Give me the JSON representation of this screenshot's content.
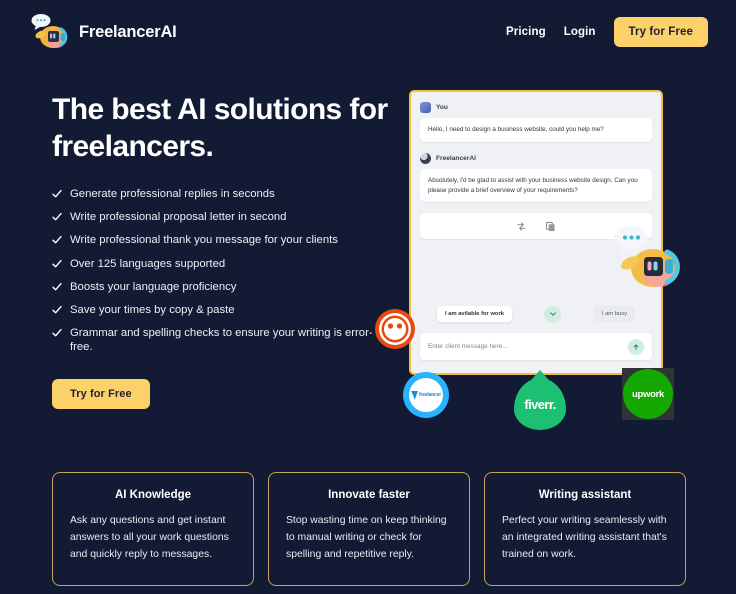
{
  "theme": {
    "background": "#131a33",
    "accent_gold": "#fcd169",
    "card_border": "#c9a257",
    "panel_border": "#f0b93f"
  },
  "header": {
    "brand_name": "FreelancerAI",
    "brand_icon": "mascot-headphones-icon",
    "nav": [
      {
        "label": "Pricing"
      },
      {
        "label": "Login"
      }
    ],
    "cta_label": "Try for Free"
  },
  "hero": {
    "headline": "The best AI solutions for freelancers.",
    "features": [
      "Generate professional replies in seconds",
      "Write professional proposal letter in second",
      "Write professional thank you message for your clients",
      "Over 125 languages supported",
      "Boosts your language proficiency",
      "Save your times by copy & paste",
      "Grammar and spelling checks to ensure your writing is error-free."
    ],
    "cta_label": "Try for Free"
  },
  "chat": {
    "messages": [
      {
        "author": "You",
        "avatar": "user-avatar",
        "text": "Hello, I need to design a business website, could you help me?"
      },
      {
        "author": "FreelancerAI",
        "avatar": "ai-avatar",
        "text": "Absolutely, I'd be glad to assist with your business website design. Can you please provide a brief overview of your requirements?"
      }
    ],
    "actions": [
      {
        "icon": "regenerate-icon"
      },
      {
        "icon": "copy-icon"
      }
    ],
    "status_left_label": "I am avilable for work",
    "status_toggle_icon": "chevron-down-icon",
    "status_right_label": "I am busy",
    "composer_placeholder": "Enter client message here...",
    "composer_value": "",
    "send_icon": "arrow-up-icon"
  },
  "badges": [
    {
      "name": "red-face-badge",
      "label": ""
    },
    {
      "name": "freelancer-badge",
      "label": "freelancer"
    },
    {
      "name": "fiverr-badge",
      "label": "fiverr."
    },
    {
      "name": "upwork-badge",
      "label": "upwork"
    }
  ],
  "cards": [
    {
      "title": "AI Knowledge",
      "text": "Ask any questions and get instant answers to all your work questions and quickly reply to messages."
    },
    {
      "title": "Innovate faster",
      "text": "Stop wasting time on keep thinking to manual writing or check for spelling and repetitive reply."
    },
    {
      "title": "Writing assistant",
      "text": "Perfect your writing seamlessly with an integrated writing assistant that's trained on work."
    }
  ]
}
